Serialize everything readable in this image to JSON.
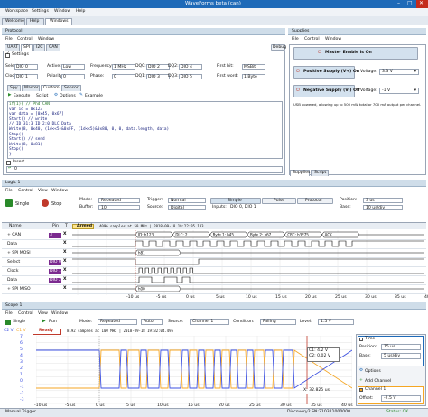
{
  "window": {
    "title": "WaveForms beta (can)"
  },
  "menubar": [
    "Workspace",
    "Settings",
    "Window",
    "Help"
  ],
  "doctabs": [
    "Welcome",
    "Help",
    "Windows"
  ],
  "protocol": {
    "title": "Protocol",
    "menu": [
      "File",
      "Control",
      "Window"
    ],
    "debug": "Debug",
    "tabs": [
      "UART",
      "SPI",
      "I2C",
      "CAN"
    ],
    "settings_label": "Settings",
    "rows": [
      {
        "l1": "Select:",
        "v1": "DIO 0",
        "l2": "Active:",
        "v2": "Low",
        "l3": "Frequency:",
        "v3": "1 MHz",
        "l4": "DQ0:",
        "v4": "DIO 2",
        "l5": "DQ2:",
        "v5": "DIO 4",
        "l6": "First bit:",
        "v6": "MSBit"
      },
      {
        "l1": "Clock:",
        "v1": "DIO 1",
        "l2": "Polarity:",
        "v2": "0",
        "l3": "Phase:",
        "v3": "0",
        "l4": "DQ1:",
        "v4": "DIO 3",
        "l5": "DQ3:",
        "v5": "DIO 5",
        "l6": "First word:",
        "v6": "1 Byte"
      }
    ],
    "subtabs": [
      "Spy",
      "Master",
      "Custom",
      "Sensor"
    ],
    "toolbar": [
      "Execute",
      "Script",
      "Options",
      "Example"
    ],
    "code": [
      "if(1){ // Phd CAN",
      "        var id = 0x123",
      "        var data = [0x45, 0x67]",
      "        Start() // write",
      "        //      ID 31:3        ID 2:0            DLC             Data",
      "        Write(8, 0x40, (1d<<5)&0xFF, (1d<<5)&0x80, 0, 0,  data.length, data)",
      "        Stop()",
      "        Start() // send",
      "        Write(8, 0x81)",
      "        Stop()",
      "    }"
    ],
    "insert_label": "Insert",
    "insert_value": "0"
  },
  "supplies": {
    "title": "Supplies",
    "menu": [
      "File",
      "Control",
      "Window"
    ],
    "master": "Master Enable is On",
    "pos": "Positive Supply (V+) On",
    "pos_voltage_label": "Voltage:",
    "pos_voltage": "3.3 V",
    "neg": "Negative Supply (V-) Off",
    "neg_voltage_label": "Voltage:",
    "neg_voltage": "-1 V",
    "usb_note": "USB powered, allowing up to 500 mW total or 700 mA output per channel.",
    "tabs": [
      "Supplies",
      "Script"
    ]
  },
  "logic": {
    "title": "Logic 1",
    "menu": [
      "File",
      "Control",
      "View",
      "Window"
    ],
    "single": "Single",
    "stop": "Stop",
    "mode_label": "Mode:",
    "mode": "Repeated",
    "buffer_label": "Buffer:",
    "buffer": "10",
    "trigger_label": "Trigger:",
    "trigger": "Normal",
    "source_label": "Source:",
    "source": "Digital",
    "simple": "Simple",
    "pulse": "Pulse",
    "protocol": "Protocol",
    "inputs_label": "Inputs:",
    "inputs": "DIO 0, DIO 1",
    "position_label": "Position:",
    "position": "3 us",
    "base_label": "Base:",
    "base": "10 us/div",
    "status": "Armed",
    "info": "4096 samples at 50 MHz | 2018-09-18 19:22:05.183",
    "col_name": "Name",
    "col_pin": "Pin",
    "col_t": "T",
    "channels": [
      {
        "name": "+ CAN",
        "pin": "3",
        "kind": "bus",
        "labels": [
          "ID: h123",
          "DLC: 2",
          "Byte 1: h45",
          "Byte 2: h67",
          "CRC: h3E75",
          "ACK"
        ]
      },
      {
        "name": "Data",
        "pin": "",
        "kind": "sig"
      },
      {
        "name": "+ SPI MOSI",
        "pin": "",
        "kind": "bus",
        "labels": [
          "h81"
        ]
      },
      {
        "name": "Select",
        "pin": "DIO 0",
        "kind": "sig"
      },
      {
        "name": "Clock",
        "pin": "DIO 1",
        "kind": "sig"
      },
      {
        "name": "Data",
        "pin": "DIO 2",
        "kind": "sig"
      },
      {
        "name": "+ SPI MISO",
        "pin": "",
        "kind": "bus",
        "labels": [
          "h00"
        ]
      }
    ],
    "ticks": [
      "-10 us",
      "-5 us",
      "0 us",
      "5 us",
      "10 us",
      "15 us",
      "20 us",
      "25 us",
      "30 us",
      "35 us",
      "40 us"
    ]
  },
  "scope": {
    "title": "Scope 1",
    "menu": [
      "File",
      "Control",
      "View",
      "Window"
    ],
    "single": "Single",
    "run": "Run",
    "mode_label": "Mode:",
    "mode": "Repeated",
    "auto": "Auto",
    "source_label": "Source:",
    "source": "Channel 1",
    "condition_label": "Condition:",
    "condition": "Falling",
    "level_label": "Level:",
    "level": "1.5 V",
    "status": "Ready",
    "info": "8192 samples at 100 MHz | 2018-09-18 19:32:04.495",
    "ch_label": "C2 V",
    "c1_label": "C1 V",
    "yvals": [
      "7",
      "6",
      "5",
      "4",
      "3",
      "2",
      "1",
      "0",
      "-1",
      "-2",
      "-3"
    ],
    "ticks": [
      "-10 us",
      "-5 us",
      "0 us",
      "5 us",
      "10 us",
      "15 us",
      "20 us",
      "25 us",
      "30 us",
      "35 us",
      "40 us"
    ],
    "cursor": {
      "c1": "C1: 4.2 V",
      "c2": "C2: 0.02 V",
      "x": "X: 32.825 us"
    },
    "time_label": "Time",
    "position_label": "Position:",
    "position": "15 us",
    "base_label": "Base:",
    "base": "5 us/div",
    "options": "Options",
    "add_channel": "Add Channel",
    "channel1": "Channel 1",
    "offset_label": "Offset:",
    "offset": "-2.5 V"
  },
  "statusbar": {
    "left": "Manual Trigger",
    "device": "Discovery2 SN:210321000000",
    "status": "Status: OK"
  },
  "colors": {
    "c1": "#f5a623",
    "c2": "#3c50e0",
    "logic": "#000000",
    "accent": "#1e6ab8"
  }
}
